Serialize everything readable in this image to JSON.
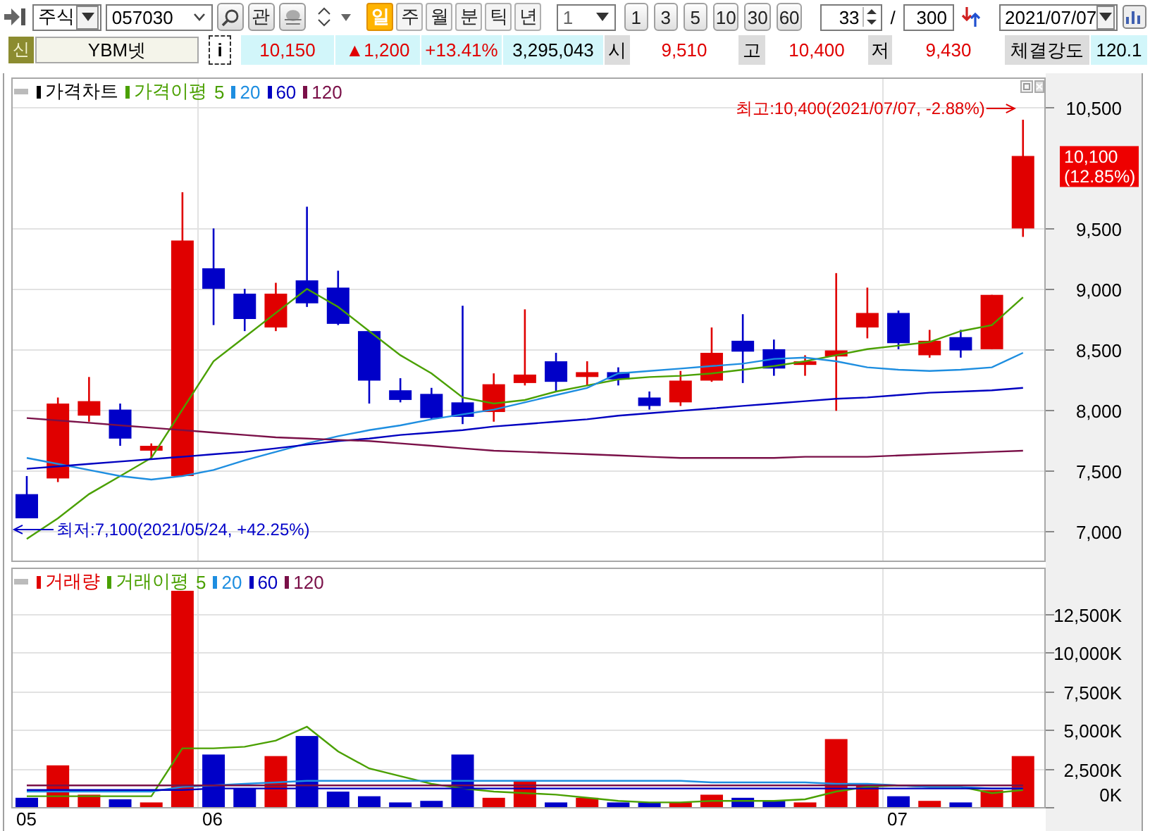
{
  "toolbar": {
    "market": "주식",
    "code": "057030",
    "related_button": "관",
    "periods": [
      {
        "label": "일",
        "selected": true
      },
      {
        "label": "주",
        "selected": false
      },
      {
        "label": "월",
        "selected": false
      },
      {
        "label": "분",
        "selected": false
      },
      {
        "label": "틱",
        "selected": false
      },
      {
        "label": "년",
        "selected": false
      }
    ],
    "interval": "1",
    "interval_buttons": [
      "1",
      "3",
      "5",
      "10",
      "30",
      "60"
    ],
    "count": "33",
    "separator": "/",
    "total": "300",
    "date": "2021/07/07"
  },
  "quote": {
    "badge": "신",
    "name": "YBM넷",
    "info_button": "i",
    "fields": [
      {
        "kind": "quote",
        "text": "10,150",
        "rising": true
      },
      {
        "kind": "quote",
        "text": "▲1,200",
        "rising": true
      },
      {
        "kind": "quote",
        "text": "+13.41%",
        "rising": true
      },
      {
        "kind": "quote",
        "text": "3,295,043",
        "rising": false
      },
      {
        "kind": "label",
        "text": "시"
      },
      {
        "kind": "value",
        "text": "9,510",
        "rising": true
      },
      {
        "kind": "label",
        "text": "고"
      },
      {
        "kind": "value",
        "text": "10,400",
        "rising": true
      },
      {
        "kind": "label",
        "text": "저"
      },
      {
        "kind": "value",
        "text": "9,430",
        "rising": true
      },
      {
        "kind": "label",
        "text": "체결강도"
      },
      {
        "kind": "quote",
        "text": "120.1",
        "rising": false
      }
    ]
  },
  "price_panel": {
    "legend": [
      {
        "text": "가격차트",
        "color": "#000000"
      },
      {
        "text": "가격이평",
        "color": "#4aa000"
      }
    ],
    "price_tag": [
      "10,100",
      "(12.85%)"
    ],
    "chart_data": {
      "type": "candlestick",
      "categories": [
        null,
        null,
        null,
        null,
        null,
        null,
        null,
        null,
        null,
        null,
        null,
        null,
        null,
        null,
        null,
        null,
        null,
        null,
        null,
        null,
        null,
        null,
        null,
        null,
        null,
        null,
        null,
        null,
        null,
        null,
        null,
        null,
        null
      ],
      "ylim": [
        6750,
        10750
      ],
      "grid": true,
      "yticks": [
        {
          "value": 7000,
          "label": "7,000"
        },
        {
          "value": 7500,
          "label": "7,500"
        },
        {
          "value": 8000,
          "label": "8,000"
        },
        {
          "value": 8500,
          "label": "8,500"
        },
        {
          "value": 9000,
          "label": "9,000"
        },
        {
          "value": 9500,
          "label": "9,500"
        },
        {
          "value": 10500,
          "label": "10,500"
        }
      ],
      "ohlc": [
        [
          7300,
          7450,
          7100,
          7100
        ],
        [
          7430,
          8100,
          7400,
          8050
        ],
        [
          7950,
          8270,
          7900,
          8070
        ],
        [
          8000,
          8050,
          7700,
          7760
        ],
        [
          7660,
          7720,
          7600,
          7700
        ],
        [
          7450,
          9800,
          7450,
          9400
        ],
        [
          9170,
          9500,
          8700,
          9000
        ],
        [
          8960,
          9000,
          8650,
          8750
        ],
        [
          8680,
          9050,
          8650,
          8960
        ],
        [
          9070,
          9680,
          8850,
          8880
        ],
        [
          9010,
          9150,
          8700,
          8710
        ],
        [
          8650,
          8650,
          8050,
          8240
        ],
        [
          8160,
          8260,
          8060,
          8080
        ],
        [
          8130,
          8180,
          7920,
          7930
        ],
        [
          8060,
          8860,
          7880,
          7940
        ],
        [
          7980,
          8300,
          7900,
          8210
        ],
        [
          8220,
          8830,
          8200,
          8290
        ],
        [
          8400,
          8470,
          8150,
          8230
        ],
        [
          8270,
          8400,
          8200,
          8310
        ],
        [
          8310,
          8350,
          8200,
          8250
        ],
        [
          8100,
          8150,
          8000,
          8030
        ],
        [
          8060,
          8320,
          8030,
          8240
        ],
        [
          8240,
          8680,
          8230,
          8470
        ],
        [
          8570,
          8790,
          8220,
          8480
        ],
        [
          8500,
          8580,
          8280,
          8340
        ],
        [
          8370,
          8450,
          8280,
          8400
        ],
        [
          8440,
          9130,
          7990,
          8490
        ],
        [
          8680,
          9010,
          8590,
          8800
        ],
        [
          8800,
          8820,
          8500,
          8550
        ],
        [
          8450,
          8660,
          8430,
          8570
        ],
        [
          8600,
          8660,
          8430,
          8490
        ],
        [
          8500,
          8950,
          8500,
          8950
        ],
        [
          9500,
          10400,
          9430,
          10100
        ]
      ],
      "series": [
        {
          "name": "5",
          "type": "line",
          "color": "#4aa000",
          "values": [
            6930,
            7100,
            7300,
            7450,
            7600,
            8000,
            8400,
            8600,
            8800,
            9000,
            8850,
            8650,
            8450,
            8300,
            8100,
            8050,
            8080,
            8150,
            8200,
            8250,
            8270,
            8280,
            8300,
            8330,
            8360,
            8400,
            8450,
            8500,
            8530,
            8560,
            8650,
            8700,
            8930
          ]
        },
        {
          "name": "20",
          "type": "line",
          "color": "#1e8ee0",
          "values": [
            7600,
            7550,
            7500,
            7450,
            7420,
            7450,
            7500,
            7580,
            7650,
            7720,
            7780,
            7830,
            7870,
            7920,
            7960,
            8000,
            8060,
            8120,
            8180,
            8300,
            8320,
            8340,
            8360,
            8380,
            8420,
            8430,
            8400,
            8350,
            8330,
            8320,
            8330,
            8350,
            8470
          ]
        },
        {
          "name": "60",
          "type": "line",
          "color": "#0000c0",
          "values": [
            7510,
            7530,
            7550,
            7570,
            7590,
            7610,
            7630,
            7650,
            7680,
            7710,
            7740,
            7760,
            7790,
            7810,
            7830,
            7860,
            7880,
            7900,
            7920,
            7950,
            7970,
            7990,
            8010,
            8030,
            8050,
            8070,
            8090,
            8100,
            8120,
            8140,
            8150,
            8160,
            8180
          ]
        },
        {
          "name": "120",
          "type": "line",
          "color": "#7a1048",
          "values": [
            7930,
            7910,
            7890,
            7870,
            7850,
            7830,
            7810,
            7790,
            7770,
            7760,
            7750,
            7740,
            7720,
            7700,
            7680,
            7660,
            7650,
            7640,
            7630,
            7620,
            7610,
            7600,
            7600,
            7600,
            7600,
            7610,
            7610,
            7610,
            7620,
            7630,
            7640,
            7650,
            7660
          ]
        }
      ],
      "annotations": [
        "최고:10,400(2021/07/07, -2.88%)",
        "최저:7,100(2021/05/24, +42.25%)"
      ]
    }
  },
  "volume_panel": {
    "legend": [
      {
        "text": "거래이평",
        "color": "#4aa000"
      }
    ],
    "chart_data": {
      "type": "bar",
      "categories": [
        "05",
        null,
        null,
        null,
        null,
        null,
        "06",
        null,
        null,
        null,
        null,
        null,
        null,
        null,
        null,
        null,
        null,
        null,
        null,
        null,
        null,
        null,
        null,
        null,
        null,
        null,
        null,
        null,
        "07",
        null,
        null,
        null,
        null
      ],
      "ylim": [
        0,
        15500
      ],
      "grid": true,
      "yticks": [
        {
          "value": 0,
          "label": "0K"
        },
        {
          "value": 2500,
          "label": "2,500K"
        },
        {
          "value": 5000,
          "label": "5,000K"
        },
        {
          "value": 7500,
          "label": "7,500K"
        },
        {
          "value": 10000,
          "label": "10,000K"
        },
        {
          "value": 12500,
          "label": "12,500K"
        }
      ],
      "series": [
        {
          "name": "거래량",
          "type": "bar",
          "colors": [
            "#0000c8",
            "#e00000",
            "#e00000",
            "#0000c8",
            "#e00000",
            "#e00000",
            "#0000c8",
            "#0000c8",
            "#e00000",
            "#0000c8",
            "#0000c8",
            "#0000c8",
            "#0000c8",
            "#0000c8",
            "#0000c8",
            "#e00000",
            "#e00000",
            "#0000c8",
            "#e00000",
            "#0000c8",
            "#0000c8",
            "#e00000",
            "#e00000",
            "#0000c8",
            "#0000c8",
            "#e00000",
            "#e00000",
            "#e00000",
            "#0000c8",
            "#e00000",
            "#0000c8",
            "#e00000",
            "#e00000"
          ],
          "values": [
            600,
            2700,
            800,
            500,
            300,
            14000,
            3400,
            1200,
            3300,
            4600,
            1000,
            700,
            300,
            400,
            3400,
            600,
            1700,
            300,
            600,
            300,
            300,
            300,
            800,
            600,
            400,
            300,
            4400,
            1500,
            700,
            400,
            300,
            1100,
            3300
          ]
        },
        {
          "name": "5",
          "type": "line",
          "color": "#4aa000",
          "values": [
            700,
            700,
            700,
            700,
            700,
            3800,
            3800,
            3900,
            4300,
            5200,
            3600,
            2500,
            2000,
            1500,
            1200,
            1000,
            900,
            800,
            600,
            400,
            300,
            300,
            400,
            400,
            400,
            500,
            1000,
            1300,
            1400,
            1300,
            1300,
            900,
            1100
          ]
        },
        {
          "name": "20",
          "type": "line",
          "color": "#1e8ee0",
          "values": [
            1000,
            1000,
            1000,
            1000,
            1000,
            1300,
            1400,
            1500,
            1600,
            1700,
            1700,
            1700,
            1700,
            1700,
            1700,
            1700,
            1700,
            1700,
            1700,
            1700,
            1700,
            1700,
            1600,
            1600,
            1600,
            1600,
            1500,
            1500,
            1400,
            1300,
            1300,
            1200,
            1200
          ]
        },
        {
          "name": "60",
          "type": "line",
          "color": "#0000c0",
          "values": [
            1100,
            1100,
            1100,
            1100,
            1100,
            1100,
            1200,
            1200,
            1200,
            1200,
            1200,
            1200,
            1200,
            1200,
            1200,
            1200,
            1200,
            1200,
            1200,
            1200,
            1200,
            1200,
            1200,
            1200,
            1200,
            1200,
            1200,
            1200,
            1200,
            1200,
            1200,
            1200,
            1200
          ]
        },
        {
          "name": "120",
          "type": "line",
          "color": "#7a1048",
          "values": [
            1400,
            1400,
            1400,
            1400,
            1400,
            1400,
            1400,
            1400,
            1400,
            1400,
            1400,
            1400,
            1400,
            1400,
            1400,
            1400,
            1400,
            1400,
            1400,
            1400,
            1400,
            1400,
            1400,
            1400,
            1400,
            1400,
            1400,
            1400,
            1400,
            1400,
            1400,
            1400,
            1400
          ]
        }
      ]
    }
  }
}
